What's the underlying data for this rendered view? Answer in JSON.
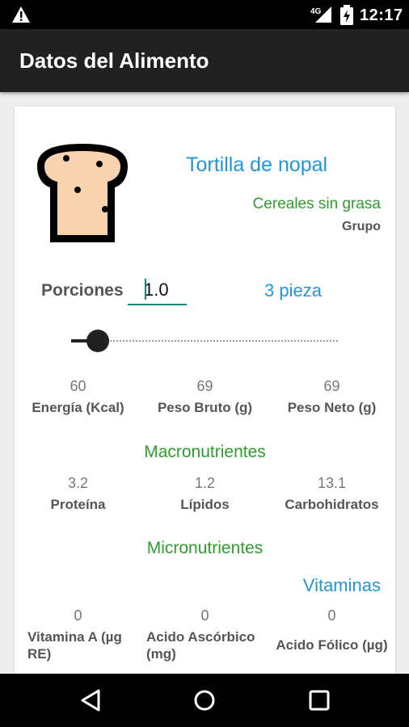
{
  "status_bar": {
    "time": "12:17",
    "network": "4G"
  },
  "toolbar": {
    "title": "Datos del Alimento"
  },
  "food": {
    "name": "Tortilla de nopal",
    "group": "Cereales sin grasa",
    "group_label": "Grupo"
  },
  "portion": {
    "label": "Porciones",
    "value": "1.0",
    "unit": "3 pieza",
    "slider_fraction": 0.1
  },
  "summary": [
    {
      "value": "60",
      "label": "Energía (Kcal)"
    },
    {
      "value": "69",
      "label": "Peso Bruto (g)"
    },
    {
      "value": "69",
      "label": "Peso Neto (g)"
    }
  ],
  "macronutrients": {
    "title": "Macronutrientes",
    "items": [
      {
        "value": "3.2",
        "label": "Proteína"
      },
      {
        "value": "1.2",
        "label": "Lípidos"
      },
      {
        "value": "13.1",
        "label": "Carbohidratos"
      }
    ]
  },
  "micronutrients": {
    "title": "Micronutrientes",
    "vitamins_title": "Vitaminas",
    "items": [
      {
        "value": "0",
        "label": "Vitamina A (µg RE)"
      },
      {
        "value": "0",
        "label": "Acido Ascórbico (mg)"
      },
      {
        "value": "0",
        "label": "Acido Fólico (µg)"
      }
    ]
  },
  "colors": {
    "accent_blue": "#2196d8",
    "accent_green": "#2e9d2e",
    "input_teal": "#0f8a7a",
    "toolbar": "#212121"
  },
  "icons": [
    "warning-icon",
    "signal-icon",
    "battery-icon",
    "bread-icon",
    "back-icon",
    "home-icon",
    "recents-icon"
  ]
}
